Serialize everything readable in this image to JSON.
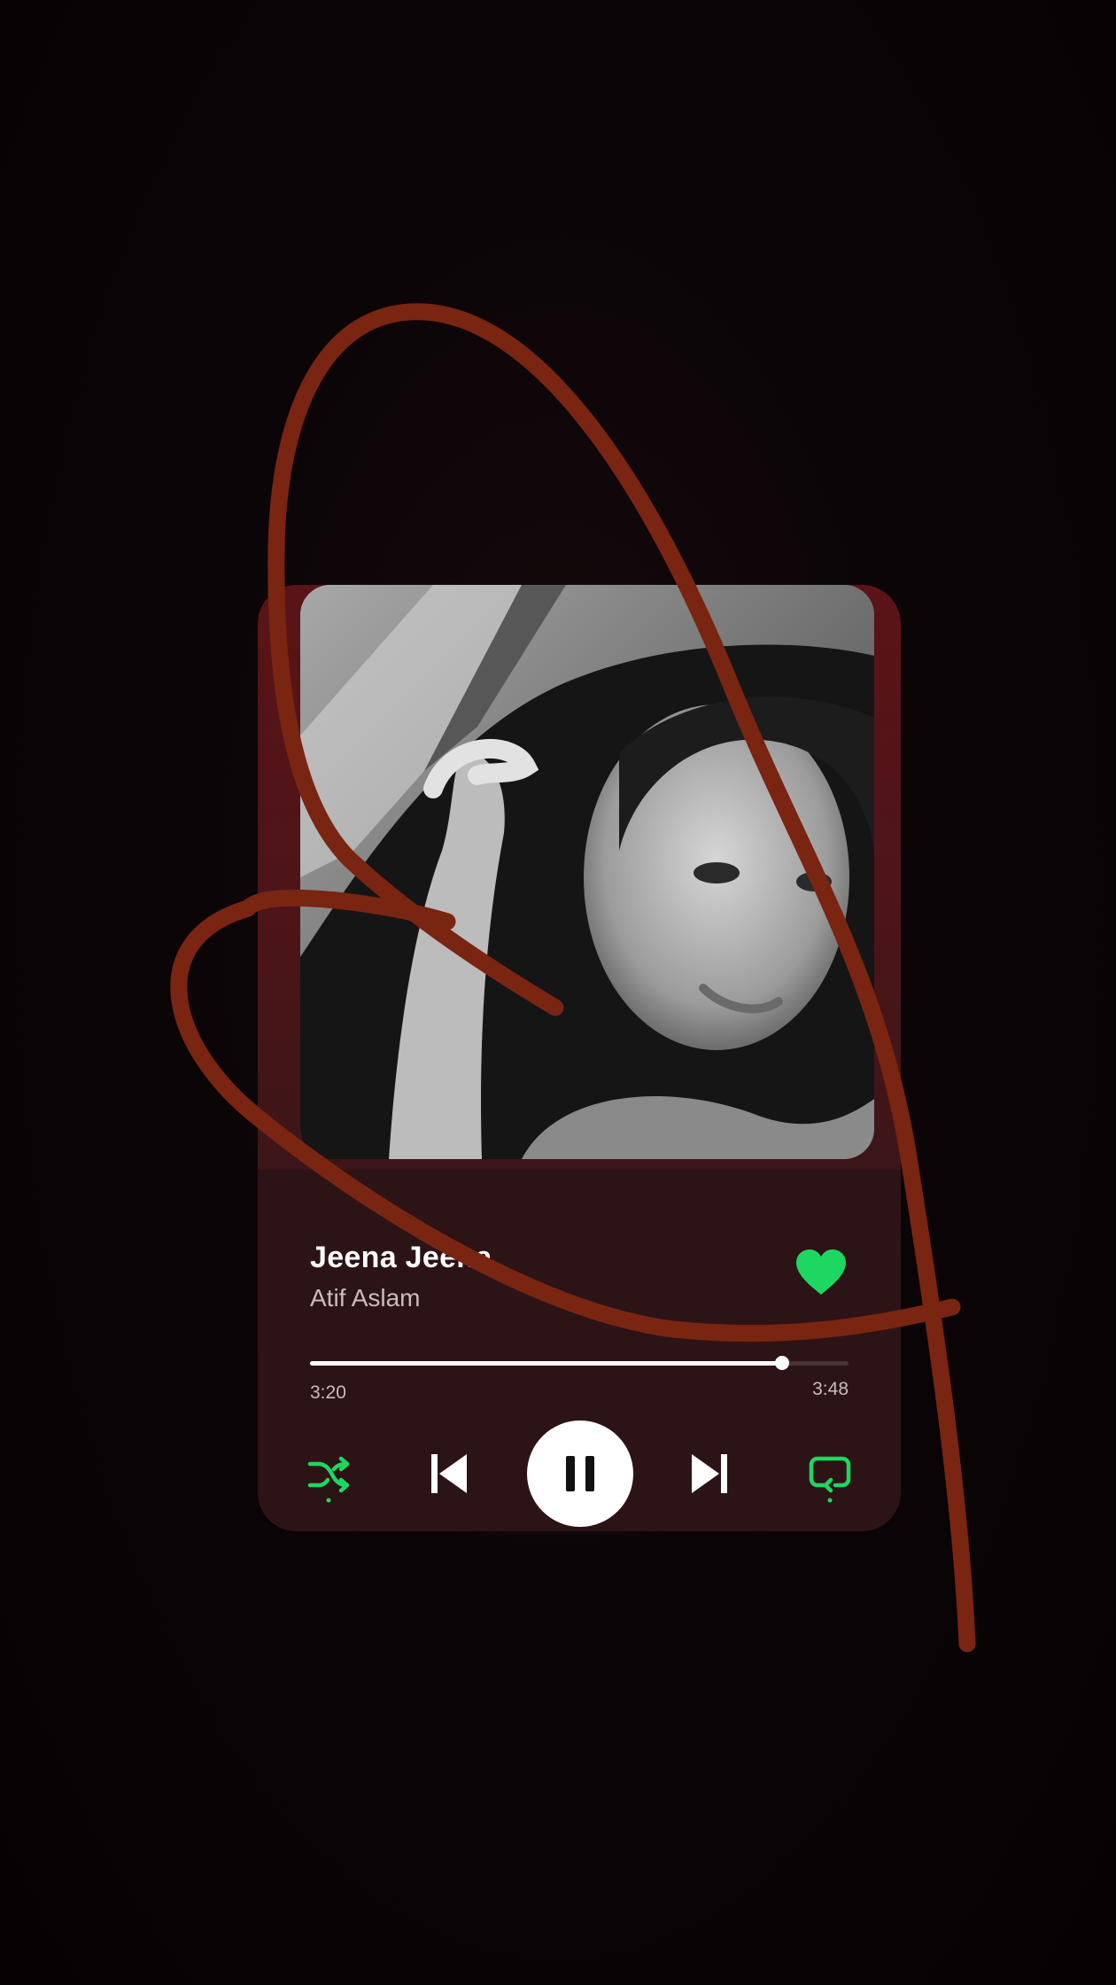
{
  "player": {
    "track_title": "Jeena Jeena",
    "artist": "Atif Aslam",
    "elapsed": "3:20",
    "duration": "3:48",
    "progress": 0.877,
    "liked": true,
    "playing": true,
    "artwork": "black-and-white portrait photo",
    "accent_color": "#1ED760",
    "card_color": "#2C1416"
  },
  "controls": {
    "shuffle": "shuffle-icon",
    "previous": "skip-previous-icon",
    "play_pause": "pause-icon",
    "next": "skip-next-icon",
    "repeat": "repeat-icon",
    "like": "heart-icon"
  },
  "overlay": {
    "scribble_color": "#7A2412"
  }
}
